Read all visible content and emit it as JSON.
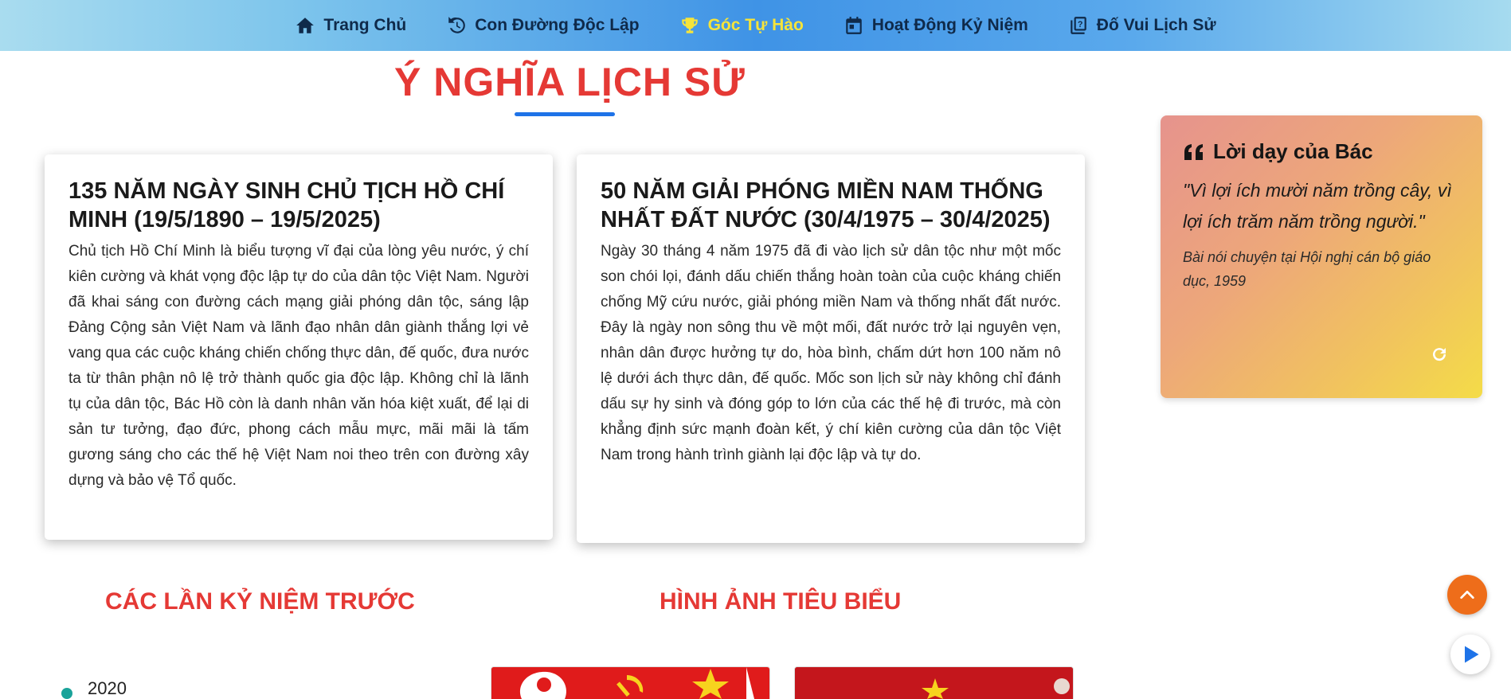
{
  "nav": {
    "items": [
      {
        "label": "Trang Chủ",
        "icon": "home-icon",
        "active": false
      },
      {
        "label": "Con Đường Độc Lập",
        "icon": "history-icon",
        "active": false
      },
      {
        "label": "Góc Tự Hào",
        "icon": "trophy-icon",
        "active": true
      },
      {
        "label": "Hoạt Động Kỷ Niệm",
        "icon": "calendar-icon",
        "active": false
      },
      {
        "label": "Đố Vui Lịch Sử",
        "icon": "quiz-icon",
        "active": false
      }
    ],
    "active_color": "#f6e43a"
  },
  "main": {
    "title": "Ý NGHĨA LỊCH SỬ",
    "cards": [
      {
        "heading": "135 NĂM NGÀY SINH CHỦ TỊCH HỒ CHÍ MINH (19/5/1890 – 19/5/2025)",
        "body": "Chủ tịch Hồ Chí Minh là biểu tượng vĩ đại của lòng yêu nước, ý chí kiên cường và khát vọng độc lập tự do của dân tộc Việt Nam. Người đã khai sáng con đường cách mạng giải phóng dân tộc, sáng lập Đảng Cộng sản Việt Nam và lãnh đạo nhân dân giành thắng lợi vẻ vang qua các cuộc kháng chiến chống thực dân, đế quốc, đưa nước ta từ thân phận nô lệ trở thành quốc gia độc lập. Không chỉ là lãnh tụ của dân tộc, Bác Hồ còn là danh nhân văn hóa kiệt xuất, để lại di sản tư tưởng, đạo đức, phong cách mẫu mực, mãi mãi là tấm gương sáng cho các thế hệ Việt Nam noi theo trên con đường xây dựng và bảo vệ Tổ quốc."
      },
      {
        "heading": "50 NĂM GIẢI PHÓNG MIỀN NAM THỐNG NHẤT ĐẤT NƯỚC (30/4/1975 – 30/4/2025)",
        "body": "Ngày 30 tháng 4 năm 1975 đã đi vào lịch sử dân tộc như một mốc son chói lọi, đánh dấu chiến thắng hoàn toàn của cuộc kháng chiến chống Mỹ cứu nước, giải phóng miền Nam và thống nhất đất nước. Đây là ngày non sông thu về một mối, đất nước trở lại nguyên vẹn, nhân dân được hưởng tự do, hòa bình, chấm dứt hơn 100 năm nô lệ dưới ách thực dân, đế quốc. Mốc son lịch sử này không chỉ đánh dấu sự hy sinh và đóng góp to lớn của các thế hệ đi trước, mà còn khẳng định sức mạnh đoàn kết, ý chí kiên cường của dân tộc Việt Nam trong hành trình giành lại độc lập và tự do."
      }
    ]
  },
  "quote": {
    "title": "Lời dạy của Bác",
    "text": "\"Vì lợi ích mười năm trồng cây, vì lợi ích trăm năm trồng người.\"",
    "source": "Bài nói chuyện tại Hội nghị cán bộ giáo dục, 1959"
  },
  "sections": {
    "past_anniversaries": "CÁC LẦN KỶ NIỆM TRƯỚC",
    "featured_images": "HÌNH ẢNH TIÊU BIỂU",
    "timeline_first_year": "2020"
  },
  "colors": {
    "accent_red": "#e53935",
    "underline_blue": "#1e73e8",
    "scroll_top_orange": "#ee6d1a",
    "play_blue": "#1e73e8"
  }
}
